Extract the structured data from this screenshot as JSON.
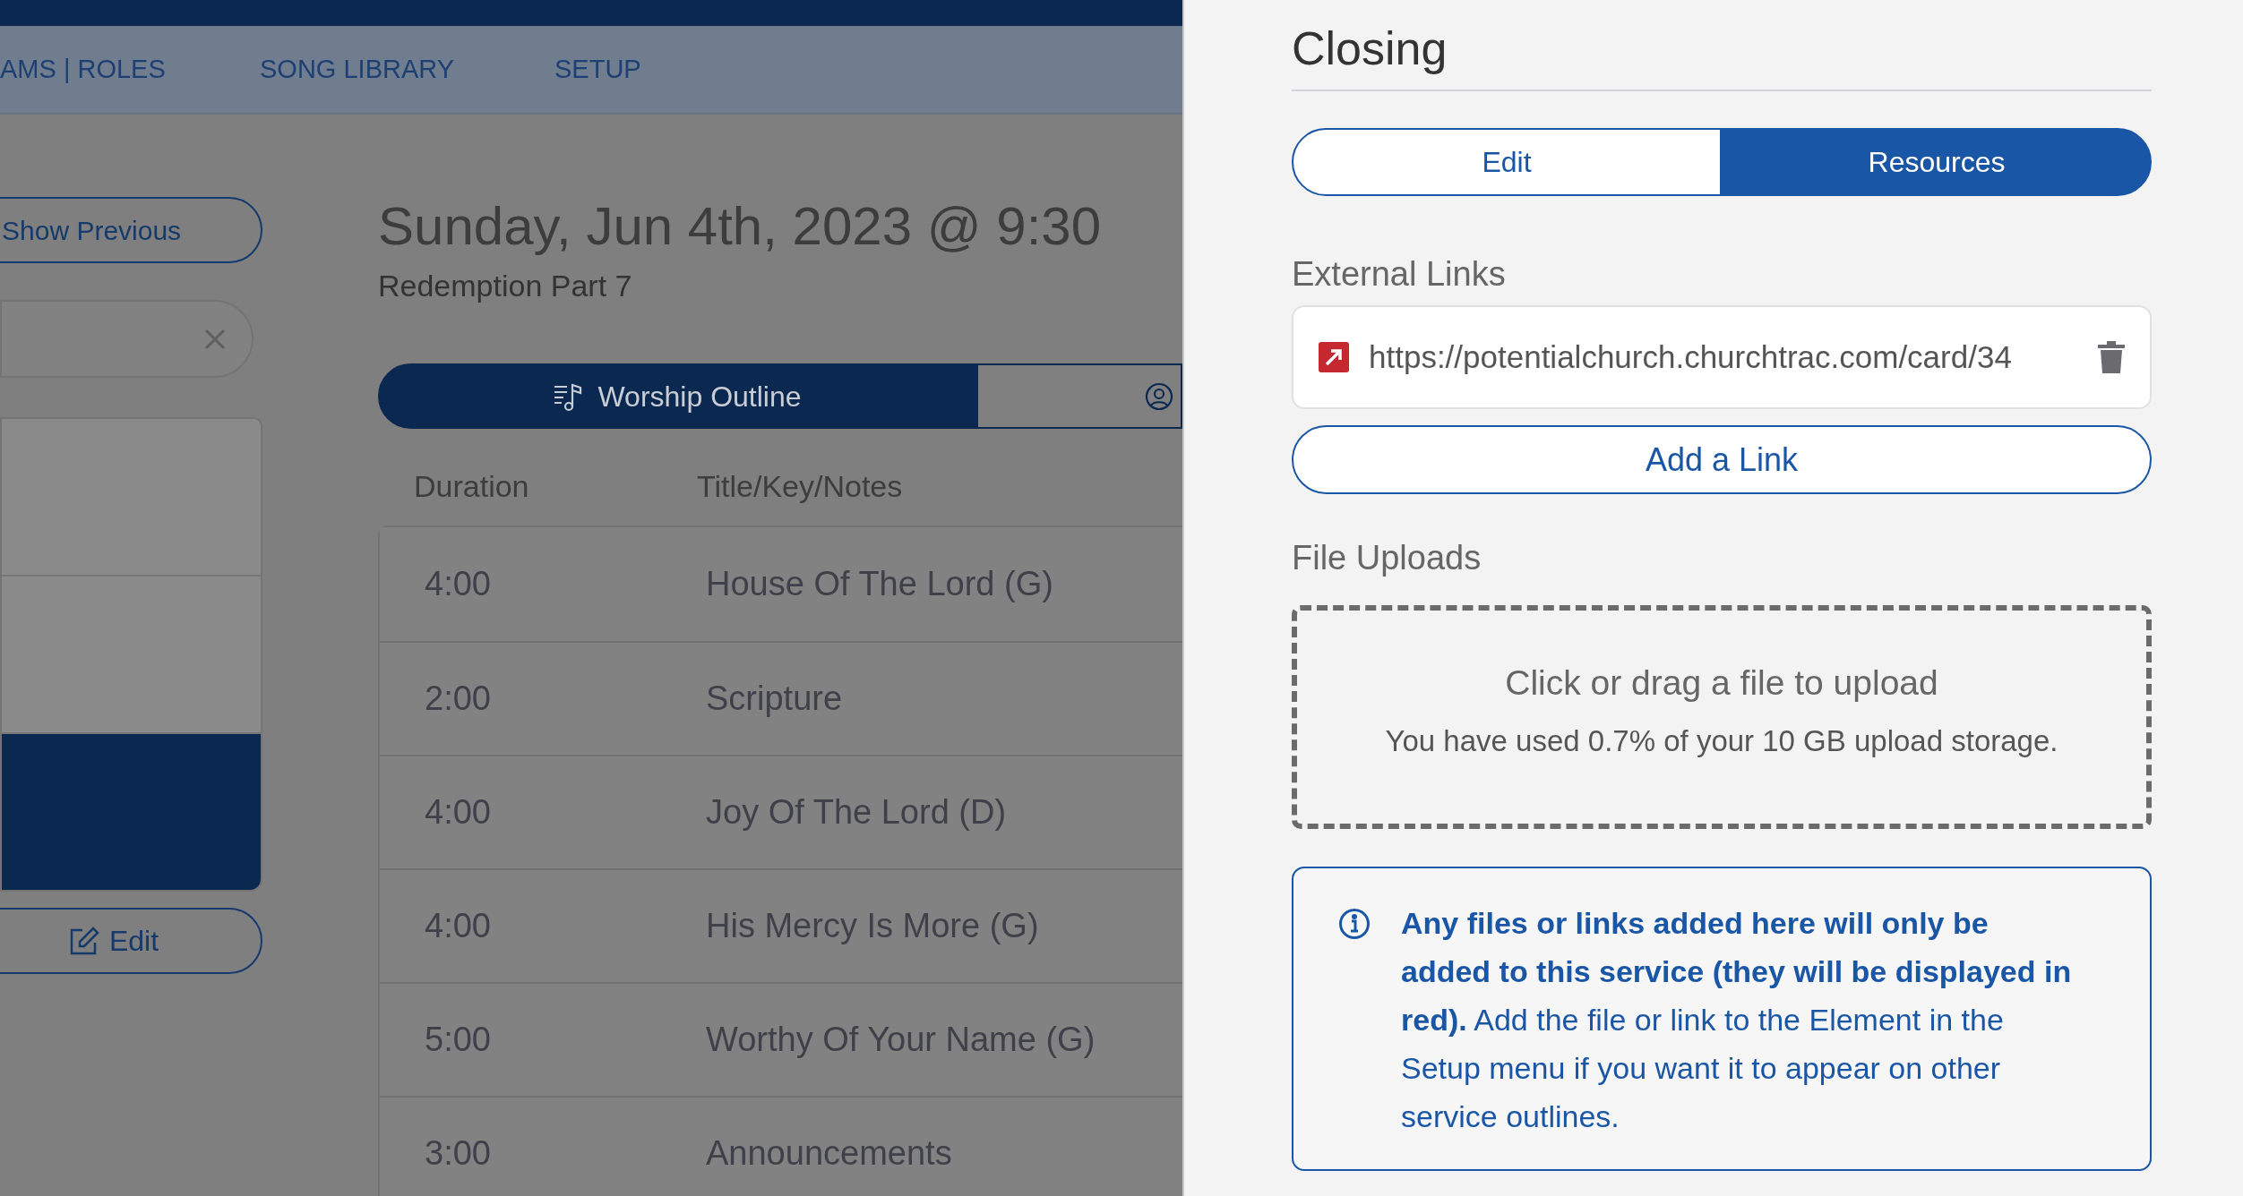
{
  "nav": {
    "items": [
      {
        "label": "AMS | ROLES"
      },
      {
        "label": "SONG LIBRARY"
      },
      {
        "label": "SETUP"
      }
    ]
  },
  "sidebar": {
    "show_previous_button": "Show Previous",
    "list_items": [
      {
        "selected": false
      },
      {
        "selected": false
      },
      {
        "selected": true
      }
    ],
    "edit_button": "Edit"
  },
  "service": {
    "title": "Sunday, Jun 4th, 2023 @ 9:30",
    "subtitle": "Redemption Part 7",
    "tabs": [
      {
        "kind": "outline",
        "label": "Worship Outline",
        "selected": true
      },
      {
        "kind": "people",
        "selected": false
      }
    ],
    "columns": [
      "Duration",
      "Title/Key/Notes"
    ],
    "rows": [
      {
        "duration": "4:00",
        "title": "House Of The Lord (G)"
      },
      {
        "duration": "2:00",
        "title": "Scripture"
      },
      {
        "duration": "4:00",
        "title": "Joy Of The Lord (D)"
      },
      {
        "duration": "4:00",
        "title": "His Mercy Is More (G)"
      },
      {
        "duration": "5:00",
        "title": "Worthy Of Your Name (G)"
      },
      {
        "duration": "3:00",
        "title": "Announcements"
      }
    ]
  },
  "panel": {
    "title": "Closing",
    "tabs": [
      {
        "label": "Edit",
        "selected": false
      },
      {
        "label": "Resources",
        "selected": true
      }
    ],
    "external_links_heading": "External Links",
    "links": [
      {
        "url": "https://potentialchurch.churchtrac.com/card/34"
      }
    ],
    "add_link_button": "Add a Link",
    "file_uploads_heading": "File Uploads",
    "dropzone": {
      "title": "Click or drag a file to upload",
      "usage": "You have used 0.7% of your 10 GB upload storage."
    },
    "info": "**Any files or links added here will only be added to this service (they will be displayed in red).** Add the file or link to the Element in the Setup menu if you want it to appear on other service outlines."
  }
}
